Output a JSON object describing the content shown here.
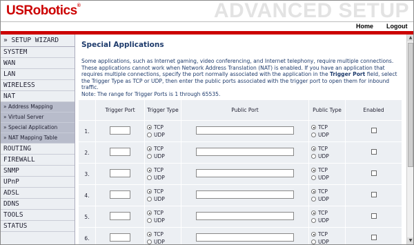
{
  "brand": {
    "logo": "USRobotics",
    "registered": "®",
    "page_title": "ADVANCED SETUP"
  },
  "topnav": {
    "home": "Home",
    "logout": "Logout"
  },
  "sidebar": {
    "wizard": "» SETUP WIZARD",
    "items": [
      "SYSTEM",
      "WAN",
      "LAN",
      "WIRELESS",
      "NAT"
    ],
    "nat_sub": [
      "» Address Mapping",
      "» Virtual Server",
      "» Special Application",
      "» NAT Mapping Table"
    ],
    "items2": [
      "ROUTING",
      "FIREWALL",
      "SNMP",
      "UPnP",
      "ADSL",
      "DDNS",
      "TOOLS",
      "STATUS"
    ]
  },
  "main": {
    "heading": "Special Applications",
    "desc_1": "Some applications, such as Internet gaming, video conferencing, and Internet telephony, require multiple connections. These applications cannot work when Network Address Translation (NAT) is enabled. If you have an application that requires multiple connections, specify the port normally associated with the application in the ",
    "desc_bold": "Trigger Port",
    "desc_2": " field, select the Trigger Type as TCP or UDP, then enter the public ports associated with the trigger port to open them for inbound traffic.",
    "note": "Note: The range for Trigger Ports is 1 through 65535."
  },
  "table": {
    "headers": {
      "trigger_port": "Trigger Port",
      "trigger_type": "Trigger Type",
      "public_port": "Public Port",
      "public_type": "Public Type",
      "enabled": "Enabled"
    },
    "tcp": "TCP",
    "udp": "UDP",
    "rows": [
      {
        "num": "1.",
        "trigger_port": "",
        "public_port": "",
        "trigger_type": "TCP",
        "public_type": "TCP",
        "enabled": false
      },
      {
        "num": "2.",
        "trigger_port": "",
        "public_port": "",
        "trigger_type": "TCP",
        "public_type": "TCP",
        "enabled": false
      },
      {
        "num": "3.",
        "trigger_port": "",
        "public_port": "",
        "trigger_type": "TCP",
        "public_type": "TCP",
        "enabled": false
      },
      {
        "num": "4.",
        "trigger_port": "",
        "public_port": "",
        "trigger_type": "TCP",
        "public_type": "TCP",
        "enabled": false
      },
      {
        "num": "5.",
        "trigger_port": "",
        "public_port": "",
        "trigger_type": "TCP",
        "public_type": "TCP",
        "enabled": false
      },
      {
        "num": "6.",
        "trigger_port": "",
        "public_port": "",
        "trigger_type": "TCP",
        "public_type": "TCP",
        "enabled": false
      }
    ]
  },
  "colors": {
    "brand_red": "#cc0000",
    "heading_blue": "#1d3a6b",
    "sidebar_bg": "#eceff3",
    "submenu_bg": "#b8bccb"
  }
}
